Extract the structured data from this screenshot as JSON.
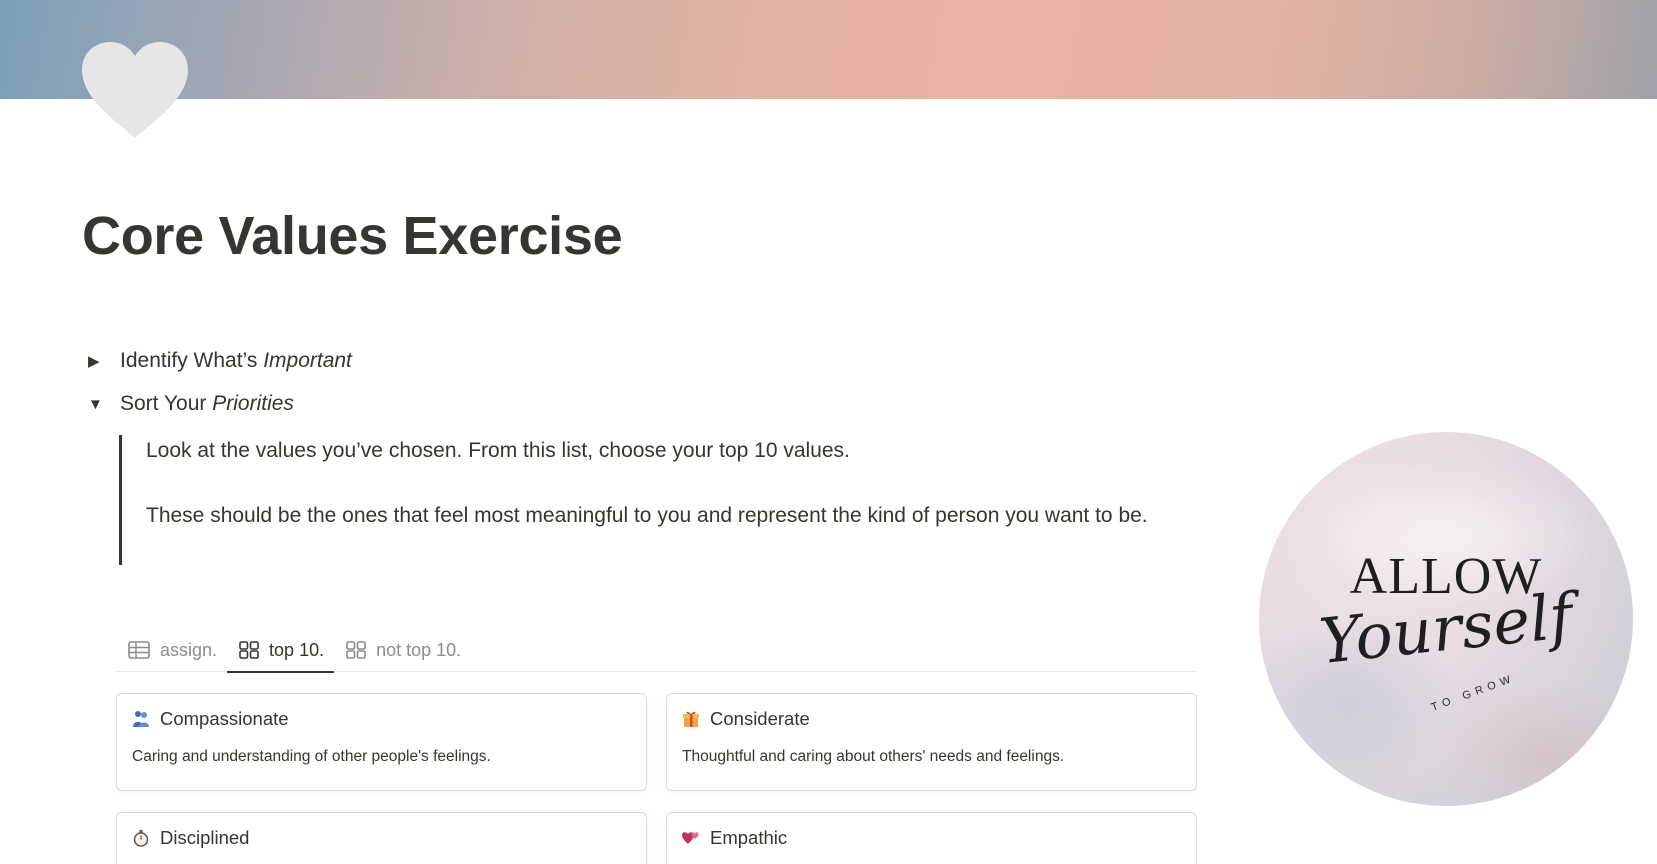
{
  "page": {
    "title": "Core Values Exercise",
    "icon": "heart-icon",
    "cover_colors": [
      "#7ba0b8",
      "#e9b3a2",
      "#9ea2a8"
    ]
  },
  "toggles": [
    {
      "prefix": "Identify What’s ",
      "emphasis": "Important",
      "state": "collapsed"
    },
    {
      "prefix": "Sort Your ",
      "emphasis": "Priorities",
      "state": "expanded"
    }
  ],
  "quote": {
    "line1": "Look at the values you’ve chosen. From this list, choose your top 10 values.",
    "line2": "These should be the ones that feel most meaningful to you and represent the kind of person you want to be."
  },
  "views": [
    {
      "label": "assign.",
      "icon": "table-icon",
      "active": false
    },
    {
      "label": "top 10.",
      "icon": "gallery-icon",
      "active": true
    },
    {
      "label": "not top 10.",
      "icon": "gallery-icon",
      "active": false
    }
  ],
  "cards": [
    {
      "title": "Compassionate",
      "emoji": "people-hugging-icon",
      "description": "Caring and understanding of other people's feelings."
    },
    {
      "title": "Considerate",
      "emoji": "gift-icon",
      "description": "Thoughtful and caring about others' needs and feelings."
    },
    {
      "title": "Disciplined",
      "emoji": "stopwatch-icon",
      "description": ""
    },
    {
      "title": "Empathic",
      "emoji": "hearts-icon",
      "description": ""
    }
  ],
  "side_image": {
    "line1": "ALLOW",
    "line2": "Yourself",
    "line3": "TO GROW"
  }
}
